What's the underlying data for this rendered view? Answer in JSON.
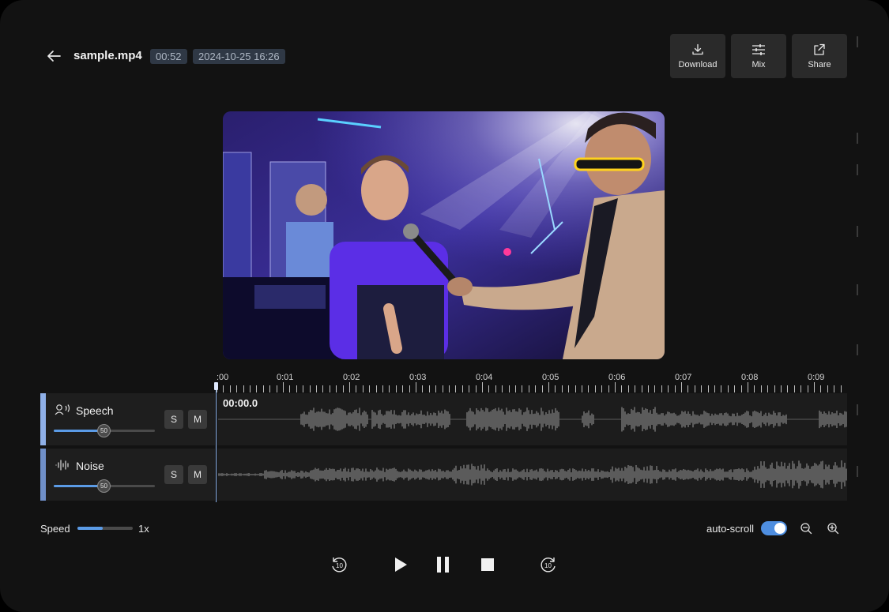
{
  "header": {
    "filename": "sample.mp4",
    "duration": "00:52",
    "date": "2024-10-25 16:26"
  },
  "toolbar": {
    "download_label": "Download",
    "mix_label": "Mix",
    "share_label": "Share"
  },
  "ruler": {
    "ticks": [
      ":00",
      "0:01",
      "0:02",
      "0:03",
      "0:04",
      "0:05",
      "0:06",
      "0:07",
      "0:08",
      "0:09"
    ]
  },
  "tracks": [
    {
      "name": "Speech",
      "volume": 50,
      "solo_label": "S",
      "mute_label": "M",
      "current_time": "00:00.0"
    },
    {
      "name": "Noise",
      "volume": 50,
      "solo_label": "S",
      "mute_label": "M"
    }
  ],
  "playback": {
    "speed_label": "Speed",
    "speed_value": "1x",
    "speed_fraction": 0.45,
    "autoscroll_label": "auto-scroll",
    "autoscroll_on": true,
    "rewind_seconds": "10",
    "forward_seconds": "10"
  },
  "colors": {
    "accent": "#5b9be6",
    "speech_track": "#8fb0e8",
    "noise_track": "#6f8fc8",
    "badge_bg": "#2f3845"
  }
}
